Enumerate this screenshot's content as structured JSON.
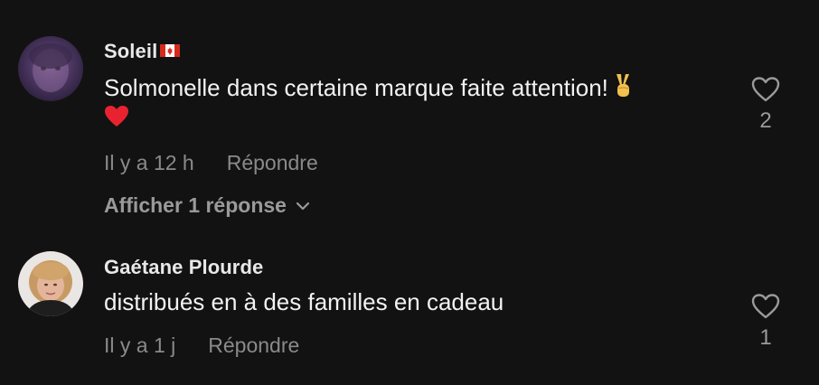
{
  "comments": [
    {
      "username": "Soleil",
      "text_line1": "Solmonelle dans certaine marque faite attention!",
      "time": "Il y a 12 h",
      "reply_label": "Répondre",
      "like_count": "2",
      "view_replies": "Afficher 1 réponse"
    },
    {
      "username": "Gaétane Plourde",
      "text_line1": "distribués en à des familles en cadeau",
      "time": "Il y a 1 j",
      "reply_label": "Répondre",
      "like_count": "1"
    }
  ],
  "colors": {
    "background": "#121212",
    "username": "#e8e8e8",
    "text": "#f2f2f2",
    "muted": "#8a8a8a"
  },
  "icons": [
    "canada-flag-icon",
    "victory-hand-icon",
    "red-heart-icon",
    "like-heart-icon",
    "chevron-down-icon"
  ]
}
